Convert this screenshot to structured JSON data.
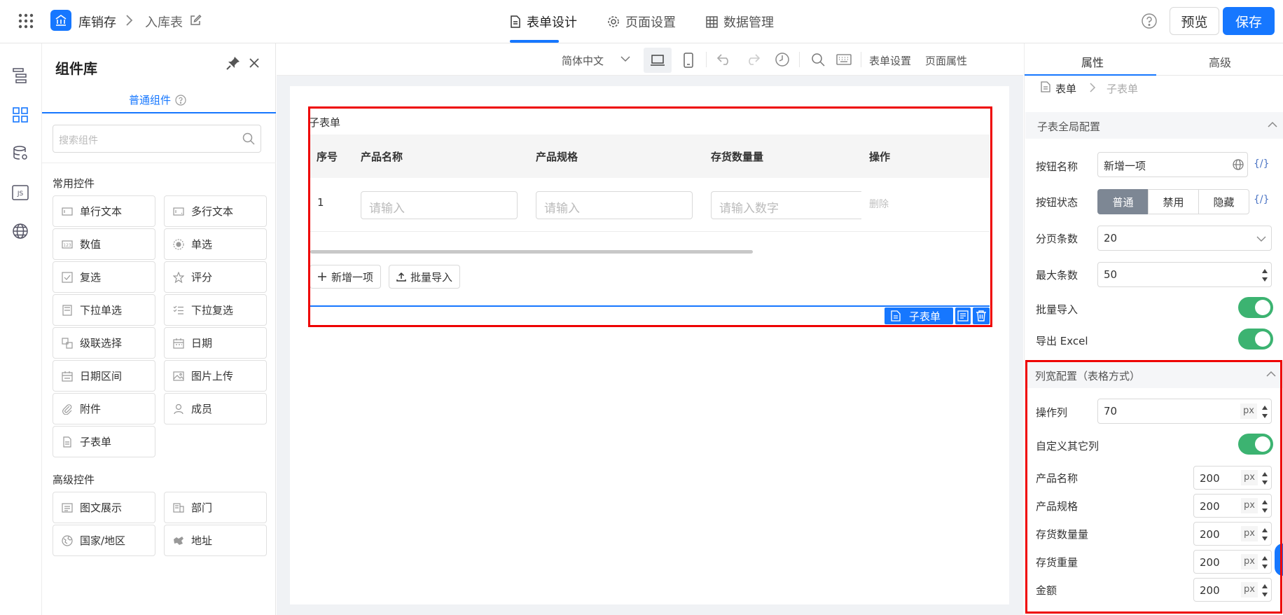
{
  "header": {
    "app_name": "库销存",
    "page_name": "入库表",
    "tabs": [
      {
        "label": "表单设计"
      },
      {
        "label": "页面设置"
      },
      {
        "label": "数据管理"
      }
    ],
    "preview_label": "预览",
    "save_label": "保存"
  },
  "components": {
    "title": "组件库",
    "tab_label": "普通组件",
    "search_placeholder": "搜索组件",
    "common_title": "常用控件",
    "common": [
      {
        "label": "单行文本"
      },
      {
        "label": "多行文本"
      },
      {
        "label": "数值"
      },
      {
        "label": "单选"
      },
      {
        "label": "复选"
      },
      {
        "label": "评分"
      },
      {
        "label": "下拉单选"
      },
      {
        "label": "下拉复选"
      },
      {
        "label": "级联选择"
      },
      {
        "label": "日期"
      },
      {
        "label": "日期区间"
      },
      {
        "label": "图片上传"
      },
      {
        "label": "附件"
      },
      {
        "label": "成员"
      },
      {
        "label": "子表单"
      }
    ],
    "advanced_title": "高级控件",
    "advanced": [
      {
        "label": "图文展示"
      },
      {
        "label": "部门"
      },
      {
        "label": "国家/地区"
      },
      {
        "label": "地址"
      }
    ]
  },
  "toolbar": {
    "language": "简体中文",
    "form_settings": "表单设置",
    "page_properties": "页面属性"
  },
  "subform": {
    "title": "子表单",
    "columns": [
      "序号",
      "产品名称",
      "产品规格",
      "存货数量量",
      "操作"
    ],
    "row": {
      "index": "1",
      "placeholder_text": "请输入",
      "placeholder_number": "请输入数字",
      "delete_label": "删除"
    },
    "add_label": "新增一项",
    "import_label": "批量导入",
    "tag_label": "子表单"
  },
  "properties": {
    "tabs": [
      {
        "label": "属性"
      },
      {
        "label": "高级"
      }
    ],
    "breadcrumb": {
      "root": "表单",
      "current": "子表单"
    },
    "global_section": "子表全局配置",
    "button_name_label": "按钮名称",
    "button_name_value": "新增一项",
    "expr_label": "{/}",
    "button_state_label": "按钮状态",
    "button_states": [
      "普通",
      "禁用",
      "隐藏"
    ],
    "page_size_label": "分页条数",
    "page_size_value": "20",
    "max_rows_label": "最大条数",
    "max_rows_value": "50",
    "batch_import_label": "批量导入",
    "batch_import_on": true,
    "export_excel_label": "导出 Excel",
    "export_excel_on": true,
    "col_width_section": "列宽配置（表格方式）",
    "action_col_label": "操作列",
    "action_col_value": "70",
    "unit": "px",
    "custom_cols_label": "自定义其它列",
    "custom_cols_on": true,
    "col_widths": [
      {
        "label": "产品名称",
        "value": "200"
      },
      {
        "label": "产品规格",
        "value": "200"
      },
      {
        "label": "存货数量量",
        "value": "200"
      },
      {
        "label": "存货重量",
        "value": "200"
      },
      {
        "label": "金额",
        "value": "200"
      }
    ]
  },
  "colors": {
    "accent": "#1677ff",
    "toggle_on": "#3cb371",
    "highlight_border": "#ee0000",
    "segment_active": "#7d8794"
  }
}
